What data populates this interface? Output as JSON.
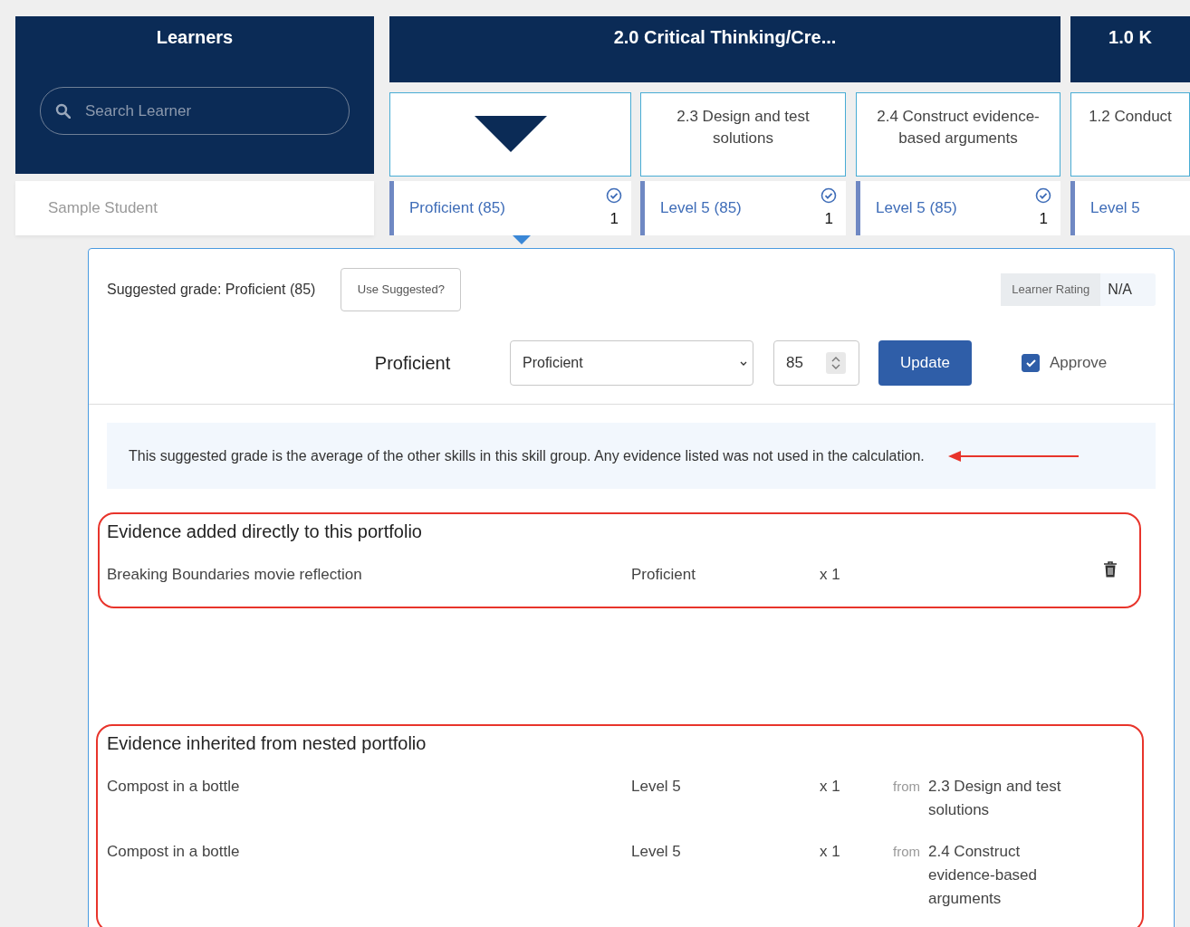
{
  "learners_panel": {
    "title": "Learners",
    "search": {
      "placeholder": "Search Learner"
    }
  },
  "learners": [
    {
      "name": "Sample Student"
    }
  ],
  "skill_groups": [
    {
      "title": "2.0 Critical Thinking/Cre...",
      "skills": [
        {
          "kind": "summary",
          "grade": "Proficient (85)",
          "approved": true,
          "count": "1",
          "selected": true
        },
        {
          "kind": "skill",
          "title": "2.3 Design and test solutions",
          "grade": "Level 5 (85)",
          "approved": true,
          "count": "1",
          "selected": false
        },
        {
          "kind": "skill",
          "title": "2.4 Construct evidence-based arguments",
          "grade": "Level 5 (85)",
          "approved": true,
          "count": "1",
          "selected": false
        }
      ]
    },
    {
      "title": "1.0 K",
      "skills": [
        {
          "kind": "skill",
          "title": "1.2 Conduct",
          "grade": "Level 5",
          "selected": false
        }
      ]
    }
  ],
  "detail": {
    "suggested_grade": "Suggested grade: Proficient (85)",
    "use_suggested_button": "Use Suggested?",
    "learner_rating": {
      "label": "Learner Rating",
      "value": "N/A"
    },
    "grade_label": "Proficient",
    "grade_select": {
      "value": "Proficient"
    },
    "score_input": {
      "value": "85"
    },
    "update_button": "Update",
    "approve": {
      "label": "Approve",
      "checked": true
    },
    "note": {
      "text": "This suggested grade is the average of the other skills in this skill group. Any evidence listed was not used in the calculation.",
      "annotated": true
    },
    "evidence_sections": [
      {
        "title": "Evidence added directly to this portfolio",
        "highlighted": true,
        "rows": [
          {
            "name": "Breaking Boundaries movie reflection",
            "grade": "Proficient",
            "count": "x 1",
            "deletable": true
          }
        ]
      },
      {
        "title": "Evidence inherited from nested portfolio",
        "highlighted": true,
        "rows": [
          {
            "name": "Compost in a bottle",
            "grade": "Level 5",
            "count": "x 1",
            "deletable": false,
            "from_label": "from",
            "source": "2.3 Design and test solutions"
          },
          {
            "name": "Compost in a bottle",
            "grade": "Level 5",
            "count": "x 1",
            "deletable": false,
            "from_label": "from",
            "source": "2.4 Construct evidence-based arguments"
          }
        ]
      }
    ]
  }
}
